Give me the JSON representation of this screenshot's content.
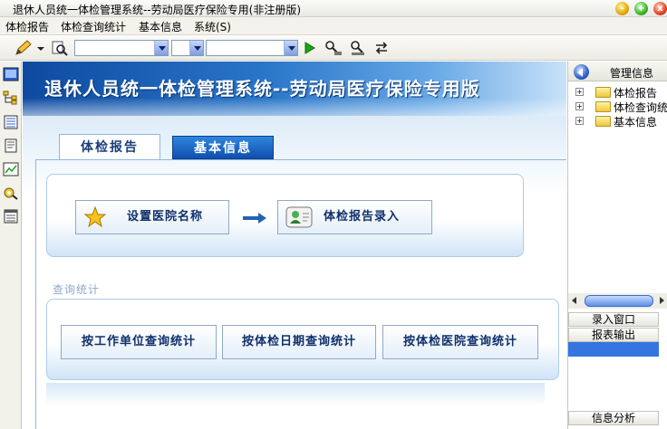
{
  "window": {
    "title": "退休人员统一体检管理系统--劳动局医疗保险专用(非注册版)",
    "minimize_glyph": "-",
    "maximize_glyph": "+",
    "close_glyph": "x"
  },
  "menu": {
    "items": [
      "体检报告",
      "体检查询统计",
      "基本信息",
      "系统(S)"
    ]
  },
  "toolbar": {
    "icons": [
      "pencil-icon",
      "search-icon",
      "run-icon",
      "people-search-icon",
      "person-search-icon",
      "refresh-icon"
    ],
    "combo_values": [
      "",
      "",
      ""
    ]
  },
  "leftbar": {
    "icons": [
      "screen-icon",
      "tree-icon",
      "list-icon",
      "document-icon",
      "chart-icon",
      "gear-search-icon",
      "report-icon"
    ]
  },
  "main": {
    "banner_title": "退休人员统一体检管理系统--劳动局医疗保险专用版",
    "tabs": [
      {
        "label": "体检报告",
        "active": true
      },
      {
        "label": "基本信息",
        "active": false
      }
    ],
    "report_actions": [
      {
        "label": "设置医院名称",
        "icon": "star-icon"
      },
      {
        "label": "体检报告录入",
        "icon": "user-card-icon"
      }
    ],
    "query_section_label": "查询统计",
    "query_actions": [
      "按工作单位查询统计",
      "按体检日期查询统计",
      "按体检医院查询统计"
    ]
  },
  "right_panel": {
    "title": "管理信息",
    "tree": [
      {
        "label": "体检报告",
        "expanded": true
      },
      {
        "label": "体检查询统"
      },
      {
        "label": "基本信息"
      }
    ],
    "sections": [
      "录入窗口",
      "报表输出",
      "信息分析"
    ]
  },
  "colors": {
    "banner_dark": "#0d4aa0",
    "tab_active_text": "#1a3d7a",
    "button_text": "#0f2f6a",
    "selection": "#3575e2"
  }
}
